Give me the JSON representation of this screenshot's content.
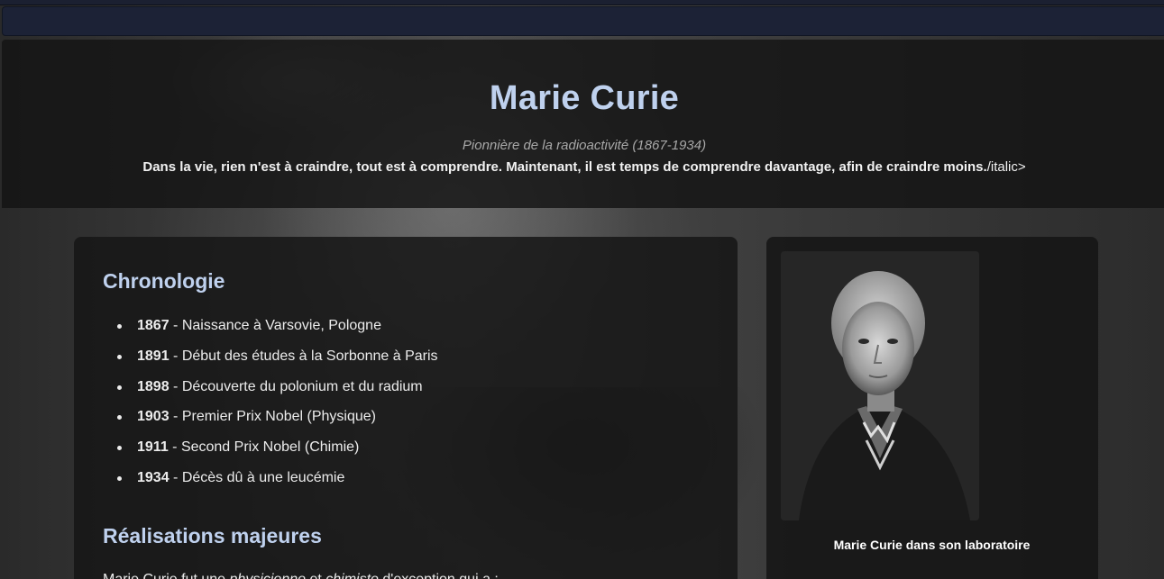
{
  "hero": {
    "title": "Marie Curie",
    "subtitle": "Pionnière de la radioactivité (1867-1934)",
    "quote_bold": "Dans la vie, rien n'est à craindre, tout est à comprendre. Maintenant, il est temps de comprendre davantage, afin de craindre moins.",
    "quote_tail": "/italic>"
  },
  "timeline": {
    "heading": "Chronologie",
    "items": [
      {
        "year": "1867",
        "text": " - Naissance à Varsovie, Pologne"
      },
      {
        "year": "1891",
        "text": " - Début des études à la Sorbonne à Paris"
      },
      {
        "year": "1898",
        "text": " - Découverte du polonium et du radium"
      },
      {
        "year": "1903",
        "text": " - Premier Prix Nobel (Physique)"
      },
      {
        "year": "1911",
        "text": " - Second Prix Nobel (Chimie)"
      },
      {
        "year": "1934",
        "text": " - Décès dû à une leucémie"
      }
    ]
  },
  "achievements": {
    "heading": "Réalisations majeures",
    "intro_1": "Marie Curie fut une ",
    "intro_em1": "physicienne",
    "intro_2": " et ",
    "intro_em2": "chimiste",
    "intro_3": " d'exception qui a :"
  },
  "sidebar": {
    "caption": "Marie Curie dans son laboratoire"
  }
}
